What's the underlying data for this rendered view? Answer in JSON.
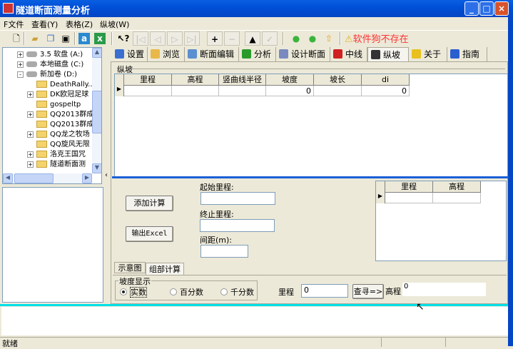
{
  "window": {
    "title": "隧道断面测量分析",
    "buttons": [
      "_",
      "□",
      "×"
    ]
  },
  "menu": [
    "F文件",
    "查看(Y)",
    "表格(Z)",
    "纵坡(W)"
  ],
  "toolbar": {
    "warning": "软件狗不存在",
    "icons": [
      "new",
      "open",
      "windows",
      "save",
      "a-icon",
      "excel",
      "whats-this",
      "first",
      "prev",
      "next",
      "last",
      "add",
      "delete",
      "up",
      "edit",
      "green-circle-1",
      "green-circle-2",
      "up-arrow"
    ]
  },
  "tree": {
    "items": [
      {
        "label": "3.5 软盘 (A:)",
        "expander": "+",
        "kind": "floppy"
      },
      {
        "label": "本地磁盘 (C:)",
        "expander": "+",
        "kind": "drive"
      },
      {
        "label": "新加卷 (D:)",
        "expander": "-",
        "kind": "drive"
      },
      {
        "label": "DeathRally...",
        "expander": "",
        "kind": "folder"
      },
      {
        "label": "DK欧冠足球",
        "expander": "+",
        "kind": "folder"
      },
      {
        "label": "gospeltp",
        "expander": "",
        "kind": "folder"
      },
      {
        "label": "QQ2013群成",
        "expander": "+",
        "kind": "folder"
      },
      {
        "label": "QQ2013群成",
        "expander": "",
        "kind": "folder"
      },
      {
        "label": "QQ龙之牧场",
        "expander": "+",
        "kind": "folder"
      },
      {
        "label": "QQ旋风无限",
        "expander": "",
        "kind": "folder"
      },
      {
        "label": "洛克王国咒",
        "expander": "+",
        "kind": "folder"
      },
      {
        "label": "隧道断面测",
        "expander": "+",
        "kind": "folder"
      }
    ]
  },
  "tabs": [
    {
      "label": "设置",
      "color": "#3a6fd0"
    },
    {
      "label": "浏览",
      "color": "#e8b84a"
    },
    {
      "label": "断面编辑",
      "color": "#5a8fd0"
    },
    {
      "label": "分析",
      "color": "#2a9a2a"
    },
    {
      "label": "设计断面",
      "color": "#7a8ac0"
    },
    {
      "label": "中线",
      "color": "#d02020"
    },
    {
      "label": "纵坡",
      "color": "#333333",
      "active": true
    },
    {
      "label": "关于",
      "color": "#e8c020"
    },
    {
      "label": "指南",
      "color": "#2a5fd0"
    }
  ],
  "slope": {
    "group_label": "纵坡",
    "columns": [
      "里程",
      "高程",
      "竖曲线半径",
      "坡度",
      "坡长",
      "di"
    ],
    "rows": [
      [
        "",
        "",
        "",
        "0",
        "",
        "0"
      ]
    ]
  },
  "calc": {
    "add_button": "添加计算",
    "export_button": "输出Excel",
    "start_label": "起始里程:",
    "start_value": "",
    "end_label": "终止里程:",
    "end_value": "",
    "interval_label": "间距(m):",
    "interval_value": "",
    "result_columns": [
      "里程",
      "高程"
    ],
    "result_rows": [
      [
        "",
        ""
      ]
    ]
  },
  "subtabs": [
    {
      "label": "示意图"
    },
    {
      "label": "组部计算",
      "active": true
    }
  ],
  "display": {
    "group_label": "坡度显示",
    "options": [
      {
        "label": "实数",
        "selected": true
      },
      {
        "label": "百分数",
        "selected": false
      },
      {
        "label": "千分数",
        "selected": false
      }
    ],
    "mileage_label": "里程",
    "mileage_value": "0",
    "search_button": "查寻=>",
    "elev_label": "高程",
    "elev_value": "0"
  },
  "status": {
    "text": "就绪"
  },
  "colors": {
    "titlebar": "#0050d8",
    "warning": "#ff3333",
    "divider": "#00e0e8"
  }
}
